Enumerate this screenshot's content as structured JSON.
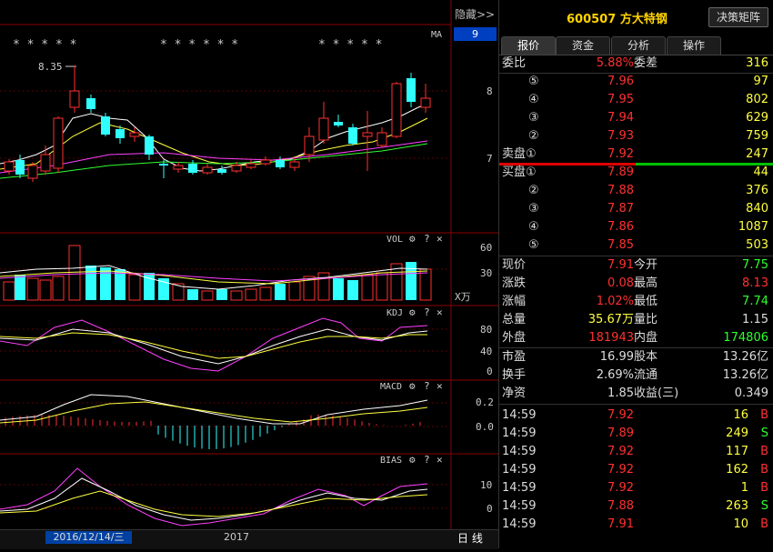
{
  "header": {
    "hide_label": "隐藏>>",
    "scale_badge": "9",
    "ma_label": "MA",
    "stars_left": "* *  * *  *",
    "stars_mid": "* * *  * *  *",
    "stars_right": "*   * *  *  *",
    "price_annotation": "8.35"
  },
  "price_axis": [
    "8",
    "7"
  ],
  "vol_panel": {
    "label": "VOL",
    "axis": [
      "60",
      "30"
    ],
    "unit": "X万"
  },
  "kdj_panel": {
    "label": "KDJ",
    "axis": [
      "80",
      "40",
      "0"
    ]
  },
  "macd_panel": {
    "label": "MACD",
    "axis": [
      "0.2",
      "0.0"
    ]
  },
  "bias_panel": {
    "label": "BIAS",
    "axis": [
      "10",
      "0"
    ]
  },
  "panel_controls": {
    "gear": "⚙",
    "help": "?",
    "close": "✕"
  },
  "bottom_bar": {
    "date": "2016/12/14/三",
    "year": "2017",
    "period": "日 线"
  },
  "stock": {
    "code": "600507",
    "name": "方大特钢",
    "decision_button": "决策矩阵"
  },
  "tabs": [
    "报价",
    "资金",
    "分析",
    "操作"
  ],
  "ratio_row": {
    "label1": "委比",
    "value1": "5.88%",
    "label2": "委差",
    "value2": "316"
  },
  "sell_orders": [
    {
      "level": "⑤",
      "price": "7.96",
      "volume": "97"
    },
    {
      "level": "④",
      "price": "7.95",
      "volume": "802"
    },
    {
      "level": "③",
      "price": "7.94",
      "volume": "629"
    },
    {
      "level": "②",
      "price": "7.93",
      "volume": "759"
    },
    {
      "level": "卖盘①",
      "price": "7.92",
      "volume": "247"
    }
  ],
  "buy_orders": [
    {
      "level": "买盘①",
      "price": "7.89",
      "volume": "44"
    },
    {
      "level": "②",
      "price": "7.88",
      "volume": "376"
    },
    {
      "level": "③",
      "price": "7.87",
      "volume": "840"
    },
    {
      "level": "④",
      "price": "7.86",
      "volume": "1087"
    },
    {
      "level": "⑤",
      "price": "7.85",
      "volume": "503"
    }
  ],
  "quote": [
    {
      "l1": "现价",
      "v1": "7.91",
      "c1": "#ff3030",
      "l2": "今开",
      "v2": "7.75",
      "c2": "#30ff30"
    },
    {
      "l1": "涨跌",
      "v1": "0.08",
      "c1": "#ff3030",
      "l2": "最高",
      "v2": "8.13",
      "c2": "#ff3030"
    },
    {
      "l1": "涨幅",
      "v1": "1.02%",
      "c1": "#ff3030",
      "l2": "最低",
      "v2": "7.74",
      "c2": "#30ff30"
    },
    {
      "l1": "总量",
      "v1": "35.67万",
      "c1": "#ffff40",
      "l2": "量比",
      "v2": "1.15",
      "c2": "#dddddd"
    },
    {
      "l1": "外盘",
      "v1": "181943",
      "c1": "#ff3030",
      "l2": "内盘",
      "v2": "174806",
      "c2": "#30ff30"
    }
  ],
  "fundamentals": [
    {
      "l1": "市盈",
      "v1": "16.99",
      "l2": "股本",
      "v2": "13.26亿"
    },
    {
      "l1": "换手",
      "v1": "2.69%",
      "l2": "流通",
      "v2": "13.26亿"
    },
    {
      "l1": "净资",
      "v1": "1.85",
      "l2": "收益(三)",
      "v2": "0.349"
    }
  ],
  "ticks": [
    {
      "time": "14:59",
      "price": "7.92",
      "vol": "16",
      "side": "B"
    },
    {
      "time": "14:59",
      "price": "7.89",
      "vol": "249",
      "side": "S"
    },
    {
      "time": "14:59",
      "price": "7.92",
      "vol": "117",
      "side": "B"
    },
    {
      "time": "14:59",
      "price": "7.92",
      "vol": "162",
      "side": "B"
    },
    {
      "time": "14:59",
      "price": "7.92",
      "vol": "1",
      "side": "B"
    },
    {
      "time": "14:59",
      "price": "7.88",
      "vol": "263",
      "side": "S"
    },
    {
      "time": "14:59",
      "price": "7.91",
      "vol": "10",
      "side": "B"
    }
  ],
  "colors": {
    "up": "#ff3030",
    "down": "#30ffff",
    "yellow": "#ffff40",
    "green": "#30ff30"
  }
}
